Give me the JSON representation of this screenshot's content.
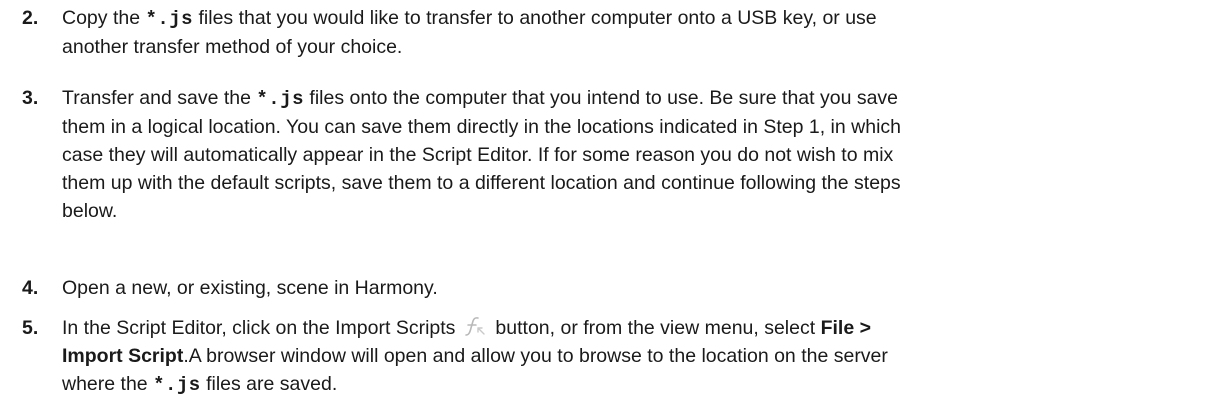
{
  "steps": [
    {
      "number": "2.",
      "parts": {
        "a": "Copy the ",
        "code1": "*.js",
        "b": " files that you would like to transfer to another computer onto a USB key, or use",
        "c": "another transfer method of your choice."
      }
    },
    {
      "number": "3.",
      "parts": {
        "a": "Transfer and save the ",
        "code1": "*.js",
        "b": " files onto the computer that you intend to use. Be sure that you save",
        "c": "them in a logical location. You can save them directly in the locations indicated in Step 1, in which",
        "d": "case they will automatically appear in the Script Editor. If for some reason you do not wish to mix",
        "e": "them up with the default scripts, save them to a different location and continue following the steps",
        "f": "below."
      }
    },
    {
      "number": "4.",
      "parts": {
        "a": "Open a new, or existing, scene in Harmony."
      }
    },
    {
      "number": "5.",
      "parts": {
        "a": "In the Script Editor, click on the Import Scripts",
        "icon": "import-script-icon",
        "b": "button, or from the view menu, select ",
        "bold1": "File >",
        "bold2": "Import Script",
        "c": ".A browser window will open and allow you to browse to the location on the server",
        "d": "where the ",
        "code1": "*.js",
        "e": " files are saved."
      }
    }
  ]
}
